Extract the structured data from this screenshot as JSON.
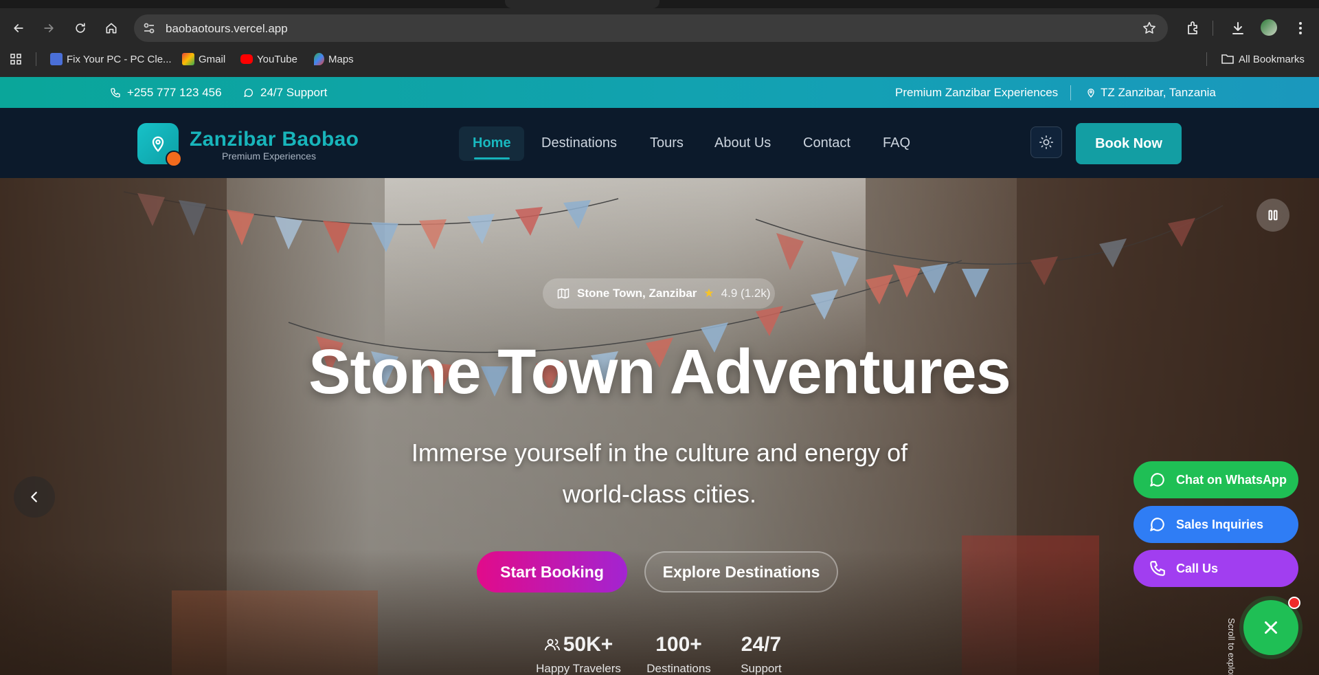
{
  "browser": {
    "url": "baobaotours.vercel.app",
    "bookmarks": [
      {
        "label": "Fix Your PC - PC Cle...",
        "icon": "pc-cleaner-icon",
        "color": "#4a6fd8"
      },
      {
        "label": "Gmail",
        "icon": "gmail-icon",
        "color": "#ea4335"
      },
      {
        "label": "YouTube",
        "icon": "youtube-icon",
        "color": "#ff0000"
      },
      {
        "label": "Maps",
        "icon": "maps-icon",
        "color": "#34a853"
      }
    ],
    "all_bookmarks_label": "All Bookmarks"
  },
  "topbar": {
    "phone": "+255 777 123 456",
    "support": "24/7 Support",
    "tagline": "Premium Zanzibar Experiences",
    "location": "TZ Zanzibar, Tanzania",
    "bg_color": "#0aa69a"
  },
  "nav": {
    "brand_name": "Zanzibar Baobao",
    "brand_tagline": "Premium Experiences",
    "links": [
      "Home",
      "Destinations",
      "Tours",
      "About Us",
      "Contact",
      "FAQ"
    ],
    "active_link": "Home",
    "cta": "Book Now",
    "accent_color": "#139ea3"
  },
  "hero": {
    "location_name": "Stone Town, Zanzibar",
    "rating": "4.9 (1.2k)",
    "title": "Stone Town Adventures",
    "subtitle": "Immerse yourself in the culture and energy of world-class cities.",
    "primary_cta": "Start Booking",
    "secondary_cta": "Explore Destinations",
    "stats": [
      {
        "value": "50K+",
        "label": "Happy Travelers"
      },
      {
        "value": "100+",
        "label": "Destinations"
      },
      {
        "value": "24/7",
        "label": "Support"
      }
    ],
    "scroll_hint": "Scroll to explore"
  },
  "contact_fab": {
    "whatsapp": "Chat on WhatsApp",
    "sales": "Sales Inquiries",
    "call": "Call Us",
    "whatsapp_color": "#1fbf55",
    "sales_color": "#2f7df5",
    "call_color": "#a13ef0"
  }
}
